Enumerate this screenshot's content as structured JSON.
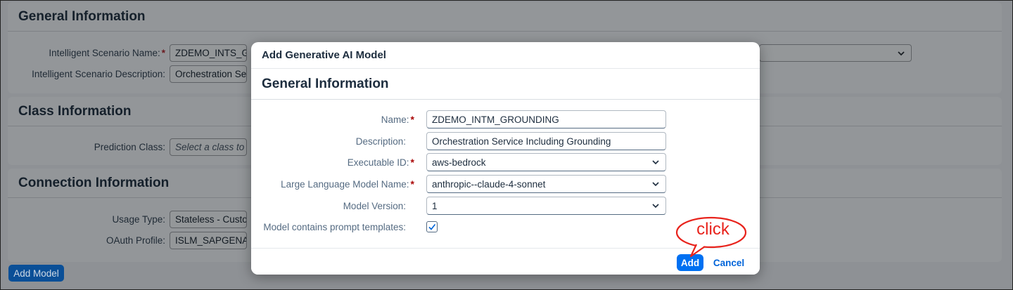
{
  "background": {
    "general_panel": {
      "title": "General Information",
      "fields": [
        {
          "label": "Intelligent Scenario Name:",
          "required": true,
          "value": "ZDEMO_INTS_G"
        },
        {
          "label": "Intelligent Scenario Description:",
          "required": false,
          "value": "Orchestration Se"
        }
      ]
    },
    "class_panel": {
      "title": "Class Information",
      "fields": [
        {
          "label": "Prediction Class:",
          "placeholder": "Select a class to"
        }
      ]
    },
    "connection_panel": {
      "title": "Connection Information",
      "fields": [
        {
          "label": "Usage Type:",
          "value": "Stateless - Custo"
        },
        {
          "label": "OAuth Profile:",
          "value": "ISLM_SAPGENA"
        }
      ]
    },
    "add_model_label": "Add Model"
  },
  "dialog": {
    "title": "Add Generative AI Model",
    "section_title": "General Information",
    "fields": {
      "name": {
        "label": "Name:",
        "required": true,
        "value": "ZDEMO_INTM_GROUNDING"
      },
      "description": {
        "label": "Description:",
        "required": false,
        "value": "Orchestration Service Including Grounding"
      },
      "executable_id": {
        "label": "Executable ID:",
        "required": true,
        "value": "aws-bedrock"
      },
      "llm_name": {
        "label": "Large Language Model Name:",
        "required": true,
        "value": "anthropic--claude-4-sonnet"
      },
      "model_version": {
        "label": "Model Version:",
        "required": false,
        "value": "1"
      },
      "prompt_templates": {
        "label": "Model contains prompt templates:",
        "checked": true
      }
    },
    "footer": {
      "add_label": "Add",
      "cancel_label": "Cancel"
    }
  },
  "annotation": {
    "text": "click",
    "color": "#e8231c"
  },
  "colors": {
    "primary": "#0070f2",
    "required": "#aa0808",
    "label": "#556b82"
  }
}
